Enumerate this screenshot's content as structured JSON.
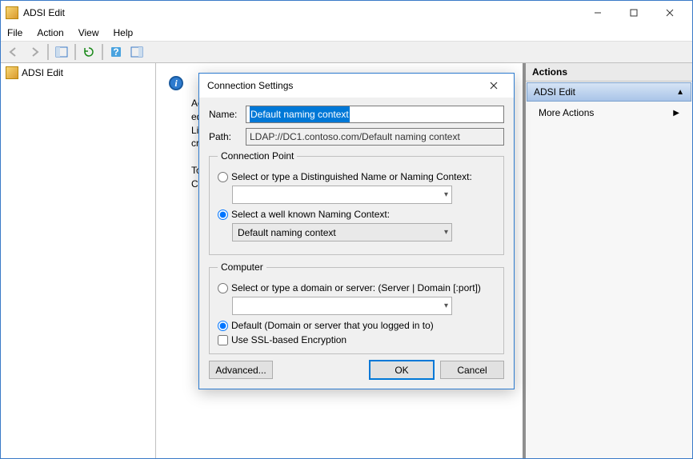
{
  "window": {
    "title": "ADSI Edit"
  },
  "menu": {
    "file": "File",
    "action": "Action",
    "view": "View",
    "help": "Help"
  },
  "tree": {
    "root": "ADSI Edit"
  },
  "mid": {
    "line1": "Acti",
    "line2": "edito",
    "line3": "Ligh",
    "line4": "crea",
    "line5": "To c",
    "line6": "Con"
  },
  "actions": {
    "header": "Actions",
    "group": "ADSI Edit",
    "more": "More Actions"
  },
  "dialog": {
    "title": "Connection Settings",
    "name_label": "Name:",
    "name_value": "Default naming context",
    "path_label": "Path:",
    "path_value": "LDAP://DC1.contoso.com/Default naming context",
    "cp_legend": "Connection Point",
    "cp_opt1": "Select or type a Distinguished Name or Naming Context:",
    "cp_opt2": "Select a well known Naming Context:",
    "cp_combo2_value": "Default naming context",
    "comp_legend": "Computer",
    "comp_opt1": "Select or type a domain or server: (Server | Domain [:port])",
    "comp_opt2": "Default (Domain or server that you logged in to)",
    "ssl": "Use SSL-based Encryption",
    "advanced": "Advanced...",
    "ok": "OK",
    "cancel": "Cancel"
  }
}
